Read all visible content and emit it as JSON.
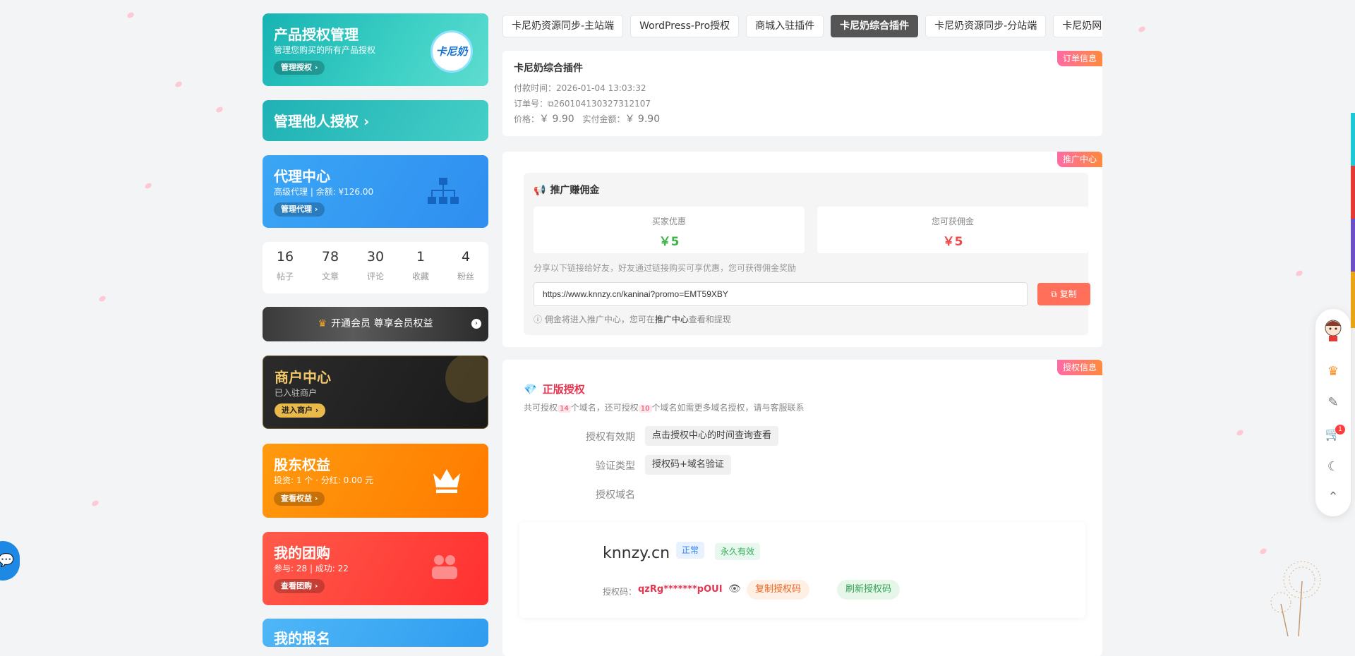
{
  "left": {
    "product": {
      "title": "产品授权管理",
      "subtitle": "管理您购买的所有产品授权",
      "button": "管理授权 ›",
      "logo": "卡尼奶"
    },
    "manage_others": {
      "title": "管理他人授权 ›"
    },
    "agent": {
      "title": "代理中心",
      "subtitle": "高级代理 | 余额: ¥126.00",
      "button": "管理代理 ›"
    },
    "stats": [
      {
        "num": "16",
        "label": "帖子"
      },
      {
        "num": "78",
        "label": "文章"
      },
      {
        "num": "30",
        "label": "评论"
      },
      {
        "num": "1",
        "label": "收藏"
      },
      {
        "num": "4",
        "label": "粉丝"
      }
    ],
    "vip": {
      "label": "开通会员 尊享会员权益"
    },
    "merchant": {
      "title": "商户中心",
      "subtitle": "已入驻商户",
      "button": "进入商户 ›"
    },
    "shareholder": {
      "title": "股东权益",
      "subtitle": "投资: 1 个 · 分红: 0.00 元",
      "button": "查看权益 ›"
    },
    "group": {
      "title": "我的团购",
      "subtitle": "参与: 28 | 成功: 22",
      "button": "查看团购 ›"
    },
    "bottom": {
      "title": "我的报名"
    }
  },
  "tabs": [
    {
      "label": "卡尼奶资源同步-主站端",
      "active": false
    },
    {
      "label": "WordPress-Pro授权",
      "active": false
    },
    {
      "label": "商城入驻插件",
      "active": false
    },
    {
      "label": "卡尼奶综合插件",
      "active": true
    },
    {
      "label": "卡尼奶资源同步-分站端",
      "active": false
    },
    {
      "label": "卡尼奶网盘插件",
      "active": false
    }
  ],
  "order": {
    "badge": "订单信息",
    "product": "卡尼奶综合插件",
    "pay_time_label": "付款时间：",
    "pay_time": "2026-01-04 13:03:32",
    "order_no_label": "订单号：",
    "order_no": "260104130327312107",
    "price_label": "价格：",
    "price": "￥ 9.90",
    "paid_label": "实付金额：",
    "paid": "￥ 9.90"
  },
  "promo": {
    "badge": "推广中心",
    "heading": "推广赚佣金",
    "buyer_label": "买家优惠",
    "buyer_value": "￥5",
    "you_label": "您可获佣金",
    "you_value": "￥5",
    "tip": "分享以下链接给好友，好友通过链接购买可享优惠，您可获得佣金奖励",
    "url": "https://www.knnzy.cn/kaninai?promo=EMT59XBY",
    "copy": "复制",
    "note_prefix": "佣金将进入推广中心，您可在",
    "note_link": "推广中心",
    "note_suffix": "查看和提现"
  },
  "license": {
    "badge": "授权信息",
    "heading": "正版授权",
    "desc_a": "共可授权",
    "total": "14",
    "desc_b": "个域名，还可授权",
    "left": "10",
    "desc_c": "个域名如需更多域名授权，请与客服联系",
    "validity_label": "授权有效期",
    "validity_value": "点击授权中心的时间查询查看",
    "verify_label": "验证类型",
    "verify_value": "授权码+域名验证",
    "domain_label": "授权域名",
    "domain": "knnzy.cn",
    "status": "正常",
    "term": "永久有效",
    "code_label": "授权码：",
    "code": "qzRg*******pOUI",
    "copy_code": "复制授权码",
    "refresh_code": "刷新授权码"
  },
  "floatbar": {
    "cart_count": "1"
  },
  "colors": {
    "accent": "#e5364f",
    "teal": "#1fb1b5",
    "orange": "#ff7a00",
    "blue": "#2f8ef0"
  }
}
